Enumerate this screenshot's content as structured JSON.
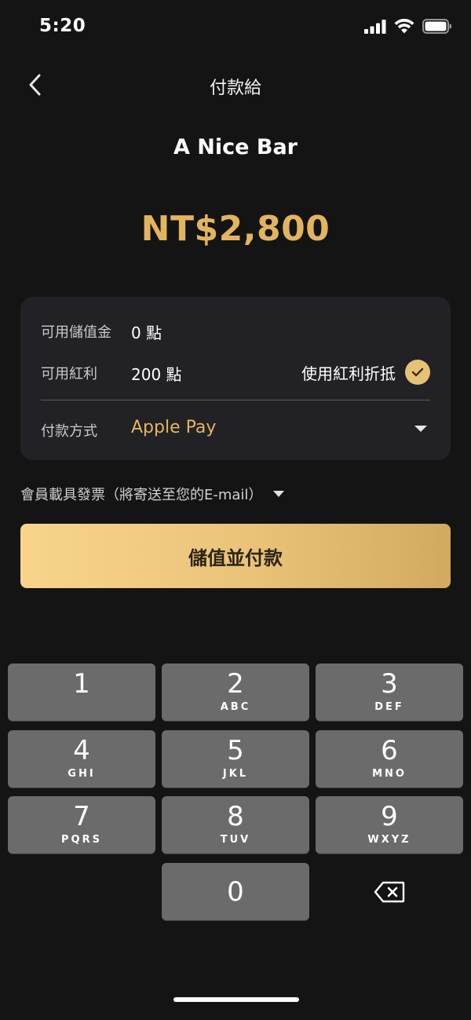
{
  "status_bar": {
    "time": "5:20"
  },
  "nav": {
    "title": "付款給",
    "back_icon": "chevron-left-icon"
  },
  "payee": {
    "name": "A Nice Bar"
  },
  "amount": "NT$2,800",
  "info_card": {
    "stored_value_label": "可用儲值金",
    "stored_value": "0 點",
    "bonus_label": "可用紅利",
    "bonus_value": "200 點",
    "use_bonus_label": "使用紅利折抵",
    "use_bonus_checked": true,
    "payment_method_label": "付款方式",
    "payment_method_value": "Apple Pay"
  },
  "invoice": {
    "label": "會員載具發票（將寄送至您的E-mail）"
  },
  "pay_button": {
    "label": "儲值並付款"
  },
  "keypad": {
    "keys": [
      {
        "digit": "1",
        "letters": ""
      },
      {
        "digit": "2",
        "letters": "ABC"
      },
      {
        "digit": "3",
        "letters": "DEF"
      },
      {
        "digit": "4",
        "letters": "GHI"
      },
      {
        "digit": "5",
        "letters": "JKL"
      },
      {
        "digit": "6",
        "letters": "MNO"
      },
      {
        "digit": "7",
        "letters": "PQRS"
      },
      {
        "digit": "8",
        "letters": "TUV"
      },
      {
        "digit": "9",
        "letters": "WXYZ"
      },
      {
        "digit": "0",
        "letters": ""
      }
    ]
  },
  "colors": {
    "background": "#141414",
    "card": "#222226",
    "accent_gold": "#e3b45f",
    "button_gradient_start": "#f8d58b",
    "button_gradient_end": "#d2a95f",
    "key": "#6b6b6b"
  }
}
